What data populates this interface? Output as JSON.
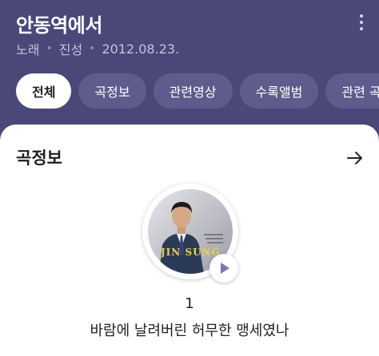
{
  "header": {
    "title": "안동역에서",
    "meta_type": "노래",
    "meta_artist": "진성",
    "meta_date": "2012.08.23.",
    "meta_separator": "•"
  },
  "tabs": [
    {
      "label": "전체",
      "active": true
    },
    {
      "label": "곡정보",
      "active": false
    },
    {
      "label": "관련영상",
      "active": false
    },
    {
      "label": "수록앨범",
      "active": false
    },
    {
      "label": "관련 곡",
      "active": false
    }
  ],
  "section": {
    "title": "곡정보"
  },
  "album": {
    "artist_logo_text": "JIN SUNG"
  },
  "song": {
    "rank": "1",
    "lyric": "바람에 날려버린 허무한 맹세였나"
  },
  "icons": {
    "more": "more-vertical-icon",
    "arrow": "arrow-right-icon",
    "play": "play-icon"
  },
  "colors": {
    "header_bg": "#4a4878",
    "tab_bg": "#5e5c8c",
    "play_accent": "#7a78b4"
  }
}
